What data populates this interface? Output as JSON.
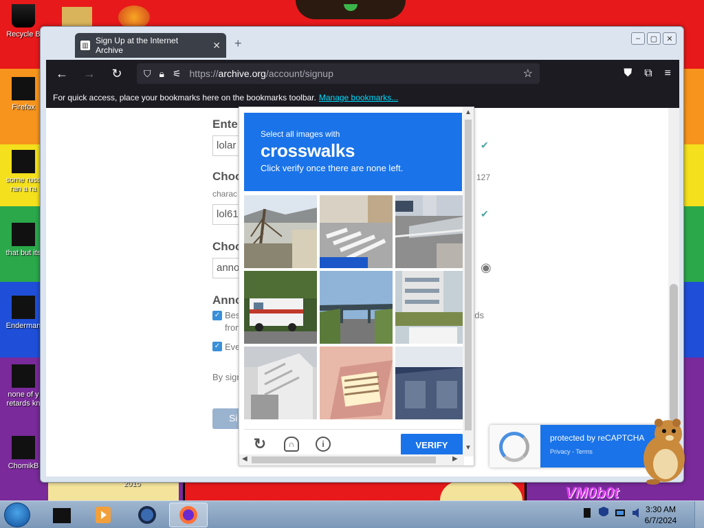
{
  "desktop": {
    "icons": [
      {
        "label": "Recycle B"
      },
      {
        "label": "Firefox"
      },
      {
        "label": "some russ",
        "label2": "ran a ra"
      },
      {
        "label": "that but its"
      },
      {
        "label": "Enderman"
      },
      {
        "label": "none of y",
        "label2": "retards kn"
      },
      {
        "label": "ChomikB"
      }
    ],
    "year_label": "2015",
    "watermark": "VM0b0t"
  },
  "browser": {
    "tab_title": "Sign Up at the Internet Archive",
    "url_scheme": "https://",
    "url_host": "archive.org",
    "url_path": "/account/signup",
    "bookmarks_hint": "For quick access, place your bookmarks here on the bookmarks toolbar.",
    "bookmarks_link": "Manage bookmarks..."
  },
  "page": {
    "email_label": "Enter",
    "email_value": "lolar",
    "username_label": "Choo",
    "username_hint": "charac",
    "username_limit": "o 127",
    "username_value": "lol61",
    "password_label": "Choo",
    "password_value": "anno",
    "announce_label": "Anno",
    "opt1": "Bes",
    "opt1_line2": "from",
    "opt1_end": "nds",
    "opt2": "Eve",
    "terms": "By sign",
    "signup_btn": "Si"
  },
  "captcha": {
    "instruction_small": "Select all images with",
    "target": "crosswalks",
    "instruction_sub": "Click verify once there are none left.",
    "verify": "VERIFY"
  },
  "badge": {
    "text": "protected by reCAPTCHA",
    "links": "Privacy - Terms"
  },
  "taskbar": {
    "time": "3:30 AM",
    "date": "6/7/2024"
  }
}
